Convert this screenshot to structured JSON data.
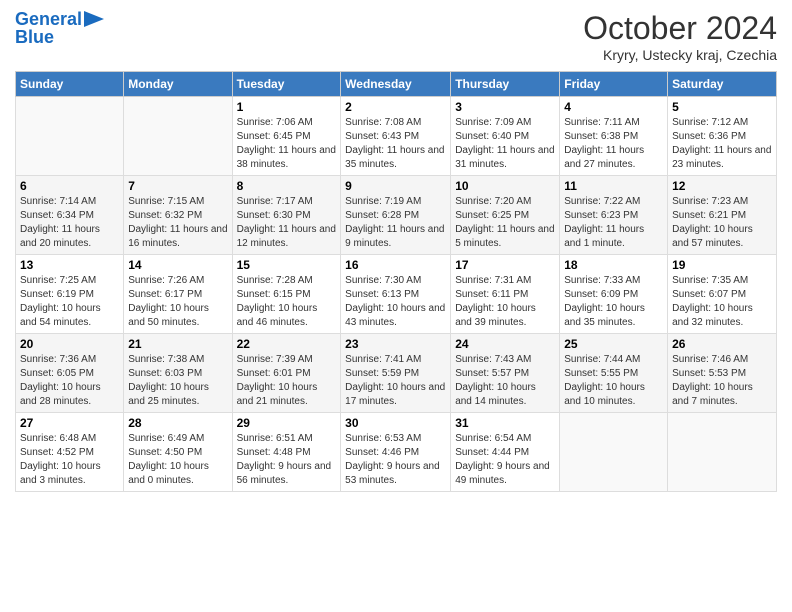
{
  "header": {
    "logo_line1": "General",
    "logo_line2": "Blue",
    "month": "October 2024",
    "location": "Kryry, Ustecky kraj, Czechia"
  },
  "weekdays": [
    "Sunday",
    "Monday",
    "Tuesday",
    "Wednesday",
    "Thursday",
    "Friday",
    "Saturday"
  ],
  "weeks": [
    [
      {
        "day": "",
        "info": ""
      },
      {
        "day": "",
        "info": ""
      },
      {
        "day": "1",
        "info": "Sunrise: 7:06 AM\nSunset: 6:45 PM\nDaylight: 11 hours and 38 minutes."
      },
      {
        "day": "2",
        "info": "Sunrise: 7:08 AM\nSunset: 6:43 PM\nDaylight: 11 hours and 35 minutes."
      },
      {
        "day": "3",
        "info": "Sunrise: 7:09 AM\nSunset: 6:40 PM\nDaylight: 11 hours and 31 minutes."
      },
      {
        "day": "4",
        "info": "Sunrise: 7:11 AM\nSunset: 6:38 PM\nDaylight: 11 hours and 27 minutes."
      },
      {
        "day": "5",
        "info": "Sunrise: 7:12 AM\nSunset: 6:36 PM\nDaylight: 11 hours and 23 minutes."
      }
    ],
    [
      {
        "day": "6",
        "info": "Sunrise: 7:14 AM\nSunset: 6:34 PM\nDaylight: 11 hours and 20 minutes."
      },
      {
        "day": "7",
        "info": "Sunrise: 7:15 AM\nSunset: 6:32 PM\nDaylight: 11 hours and 16 minutes."
      },
      {
        "day": "8",
        "info": "Sunrise: 7:17 AM\nSunset: 6:30 PM\nDaylight: 11 hours and 12 minutes."
      },
      {
        "day": "9",
        "info": "Sunrise: 7:19 AM\nSunset: 6:28 PM\nDaylight: 11 hours and 9 minutes."
      },
      {
        "day": "10",
        "info": "Sunrise: 7:20 AM\nSunset: 6:25 PM\nDaylight: 11 hours and 5 minutes."
      },
      {
        "day": "11",
        "info": "Sunrise: 7:22 AM\nSunset: 6:23 PM\nDaylight: 11 hours and 1 minute."
      },
      {
        "day": "12",
        "info": "Sunrise: 7:23 AM\nSunset: 6:21 PM\nDaylight: 10 hours and 57 minutes."
      }
    ],
    [
      {
        "day": "13",
        "info": "Sunrise: 7:25 AM\nSunset: 6:19 PM\nDaylight: 10 hours and 54 minutes."
      },
      {
        "day": "14",
        "info": "Sunrise: 7:26 AM\nSunset: 6:17 PM\nDaylight: 10 hours and 50 minutes."
      },
      {
        "day": "15",
        "info": "Sunrise: 7:28 AM\nSunset: 6:15 PM\nDaylight: 10 hours and 46 minutes."
      },
      {
        "day": "16",
        "info": "Sunrise: 7:30 AM\nSunset: 6:13 PM\nDaylight: 10 hours and 43 minutes."
      },
      {
        "day": "17",
        "info": "Sunrise: 7:31 AM\nSunset: 6:11 PM\nDaylight: 10 hours and 39 minutes."
      },
      {
        "day": "18",
        "info": "Sunrise: 7:33 AM\nSunset: 6:09 PM\nDaylight: 10 hours and 35 minutes."
      },
      {
        "day": "19",
        "info": "Sunrise: 7:35 AM\nSunset: 6:07 PM\nDaylight: 10 hours and 32 minutes."
      }
    ],
    [
      {
        "day": "20",
        "info": "Sunrise: 7:36 AM\nSunset: 6:05 PM\nDaylight: 10 hours and 28 minutes."
      },
      {
        "day": "21",
        "info": "Sunrise: 7:38 AM\nSunset: 6:03 PM\nDaylight: 10 hours and 25 minutes."
      },
      {
        "day": "22",
        "info": "Sunrise: 7:39 AM\nSunset: 6:01 PM\nDaylight: 10 hours and 21 minutes."
      },
      {
        "day": "23",
        "info": "Sunrise: 7:41 AM\nSunset: 5:59 PM\nDaylight: 10 hours and 17 minutes."
      },
      {
        "day": "24",
        "info": "Sunrise: 7:43 AM\nSunset: 5:57 PM\nDaylight: 10 hours and 14 minutes."
      },
      {
        "day": "25",
        "info": "Sunrise: 7:44 AM\nSunset: 5:55 PM\nDaylight: 10 hours and 10 minutes."
      },
      {
        "day": "26",
        "info": "Sunrise: 7:46 AM\nSunset: 5:53 PM\nDaylight: 10 hours and 7 minutes."
      }
    ],
    [
      {
        "day": "27",
        "info": "Sunrise: 6:48 AM\nSunset: 4:52 PM\nDaylight: 10 hours and 3 minutes."
      },
      {
        "day": "28",
        "info": "Sunrise: 6:49 AM\nSunset: 4:50 PM\nDaylight: 10 hours and 0 minutes."
      },
      {
        "day": "29",
        "info": "Sunrise: 6:51 AM\nSunset: 4:48 PM\nDaylight: 9 hours and 56 minutes."
      },
      {
        "day": "30",
        "info": "Sunrise: 6:53 AM\nSunset: 4:46 PM\nDaylight: 9 hours and 53 minutes."
      },
      {
        "day": "31",
        "info": "Sunrise: 6:54 AM\nSunset: 4:44 PM\nDaylight: 9 hours and 49 minutes."
      },
      {
        "day": "",
        "info": ""
      },
      {
        "day": "",
        "info": ""
      }
    ]
  ]
}
